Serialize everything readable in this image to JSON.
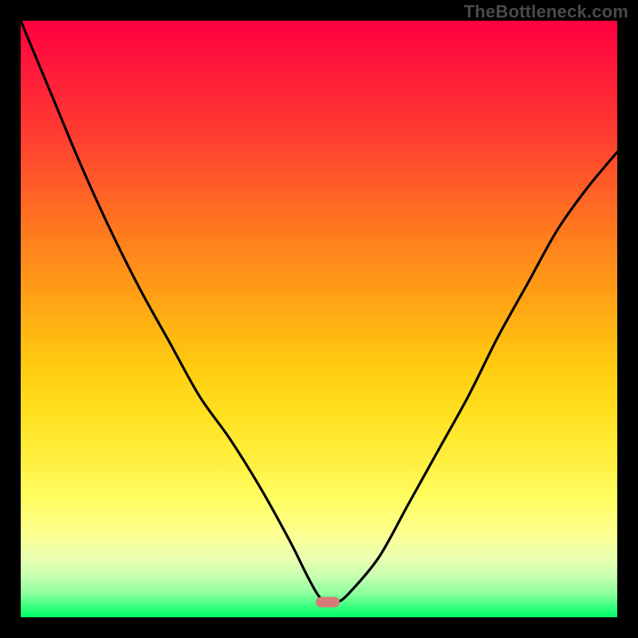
{
  "watermark": "TheBottleneck.com",
  "chart_data": {
    "type": "line",
    "title": "",
    "xlabel": "",
    "ylabel": "",
    "xlim": [
      0,
      1
    ],
    "ylim": [
      0,
      1
    ],
    "series": [
      {
        "name": "bottleneck-curve",
        "x": [
          0.0,
          0.05,
          0.1,
          0.15,
          0.2,
          0.25,
          0.3,
          0.35,
          0.4,
          0.45,
          0.48,
          0.5,
          0.515,
          0.53,
          0.55,
          0.6,
          0.65,
          0.7,
          0.75,
          0.8,
          0.85,
          0.9,
          0.95,
          1.0
        ],
        "y": [
          1.0,
          0.88,
          0.76,
          0.65,
          0.55,
          0.46,
          0.37,
          0.3,
          0.22,
          0.13,
          0.07,
          0.035,
          0.025,
          0.025,
          0.04,
          0.1,
          0.19,
          0.28,
          0.37,
          0.47,
          0.56,
          0.65,
          0.72,
          0.78
        ]
      }
    ],
    "optimum_marker": {
      "x": 0.515,
      "y": 0.025,
      "color": "#d77a77"
    },
    "gradient_stops": [
      {
        "pos": 0.0,
        "color": "#ff0040"
      },
      {
        "pos": 0.5,
        "color": "#ffcc10"
      },
      {
        "pos": 0.85,
        "color": "#fdff90"
      },
      {
        "pos": 1.0,
        "color": "#00ff66"
      }
    ]
  }
}
